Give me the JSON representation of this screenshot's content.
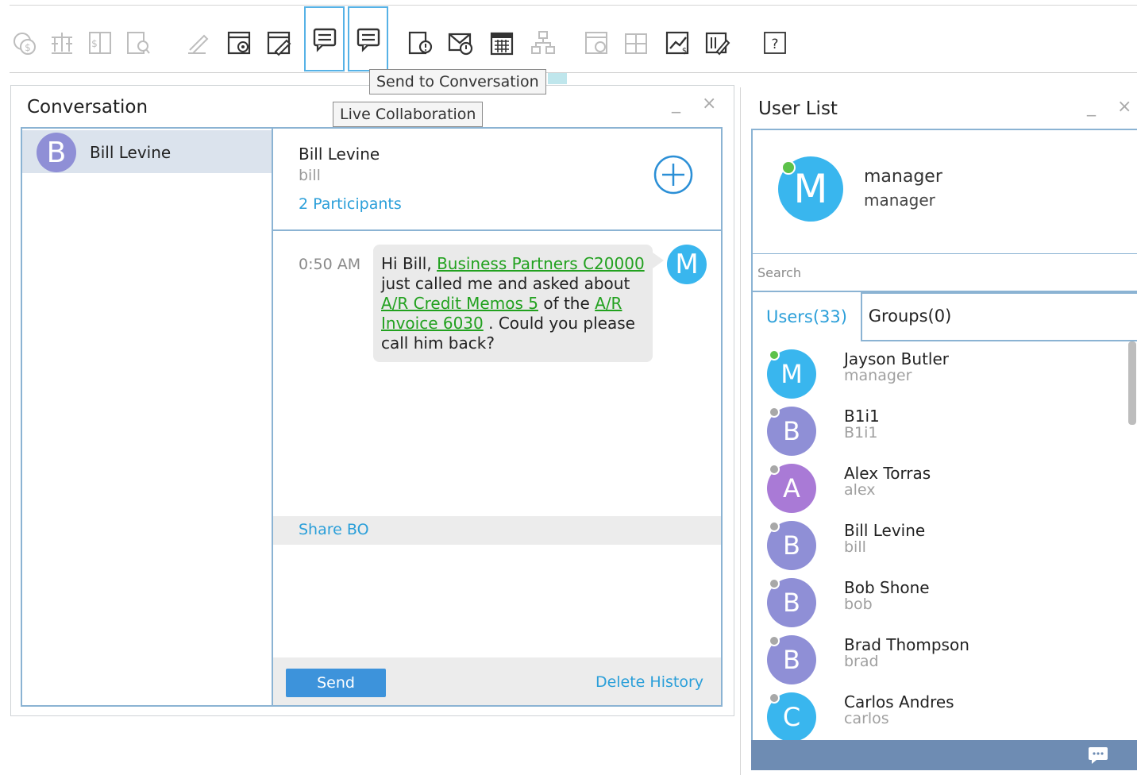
{
  "toolbar": {
    "icons": [
      "currency-icon",
      "balance-icon",
      "price-list-icon",
      "query-icon",
      "edit-icon",
      "settings-form-icon",
      "edit-form-icon",
      "conversation-icon",
      "send-to-conversation-icon",
      "alert-icon",
      "message-icon",
      "calendar-icon",
      "org-chart-icon",
      "dashboard-icon",
      "layout-icon",
      "report-icon",
      "export-icon",
      "help-icon"
    ],
    "help_label": "?"
  },
  "tooltips": {
    "send_to_conversation": "Send to Conversation",
    "live_collaboration": "Live Collaboration"
  },
  "conversation_panel": {
    "title": "Conversation",
    "minimize": "_",
    "close": "×",
    "list": [
      {
        "initial": "B",
        "name": "Bill Levine"
      }
    ],
    "chat": {
      "name": "Bill Levine",
      "user": "bill",
      "participants": "2 Participants",
      "message": {
        "time": "0:50 AM",
        "avatar_initial": "M",
        "parts": {
          "p1": "Hi Bill, ",
          "link1": "Business Partners C20000",
          "p2": " just called me and asked about ",
          "link2": "A/R Credit Memos 5",
          "p3": " of the ",
          "link3": "A/R Invoice 6030",
          "p4": " . Could you please call him back?"
        }
      },
      "share_label": "Share BO",
      "send_label": "Send",
      "delete_label": "Delete History"
    }
  },
  "user_panel": {
    "title": "User List",
    "minimize": "_",
    "close": "×",
    "profile": {
      "initial": "M",
      "name": "manager",
      "sub": "manager"
    },
    "search_placeholder": "Search",
    "tab_users": "Users(33)",
    "tab_groups": "Groups(0)",
    "users": [
      {
        "initial": "M",
        "name": "Jayson Butler",
        "login": "manager",
        "color": "#39b6ee",
        "status": "#5cc24a"
      },
      {
        "initial": "B",
        "name": "B1i1",
        "login": "B1i1",
        "color": "#8f8fd6",
        "status": "#a8a8a8"
      },
      {
        "initial": "A",
        "name": "Alex Torras",
        "login": "alex",
        "color": "#a97ad6",
        "status": "#a8a8a8"
      },
      {
        "initial": "B",
        "name": "Bill Levine",
        "login": "bill",
        "color": "#8f8fd6",
        "status": "#a8a8a8"
      },
      {
        "initial": "B",
        "name": "Bob Shone",
        "login": "bob",
        "color": "#8f8fd6",
        "status": "#a8a8a8"
      },
      {
        "initial": "B",
        "name": "Brad Thompson",
        "login": "brad",
        "color": "#8f8fd6",
        "status": "#a8a8a8"
      },
      {
        "initial": "C",
        "name": "Carlos Andres",
        "login": "carlos",
        "color": "#39b6ee",
        "status": "#a8a8a8"
      }
    ]
  }
}
